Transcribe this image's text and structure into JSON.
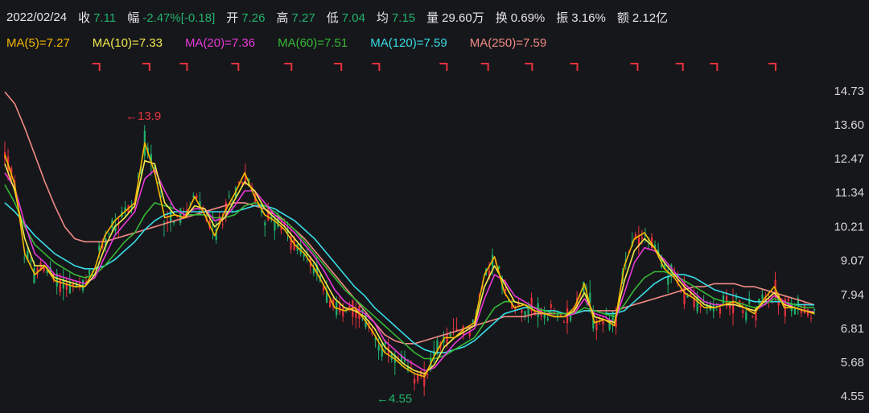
{
  "info": {
    "date": "2022/02/24",
    "close_label": "收",
    "close": "7.11",
    "change_label": "幅",
    "change": "-2.47%[-0.18]",
    "open_label": "开",
    "open": "7.26",
    "high_label": "高",
    "high": "7.27",
    "low_label": "低",
    "low": "7.04",
    "avg_label": "均",
    "avg": "7.15",
    "volume_label": "量",
    "volume": "29.60万",
    "turnover_label": "换",
    "turnover": "0.69%",
    "amplitude_label": "振",
    "amplitude": "3.16%",
    "amount_label": "额",
    "amount": "2.12亿"
  },
  "colors": {
    "background": "#16171b",
    "up": "#e8323c",
    "down": "#21b36b",
    "ma5": "#f5b800",
    "ma10": "#f2e94e",
    "ma20": "#e83ad8",
    "ma60": "#35b835",
    "ma120": "#38dde6",
    "ma250": "#f08a82"
  },
  "chart_data": {
    "type": "line",
    "yticks": [
      14.73,
      13.6,
      12.47,
      11.34,
      10.21,
      9.07,
      7.94,
      6.81,
      5.68,
      4.55
    ],
    "ylim": [
      4.55,
      14.73
    ],
    "annotations": [
      {
        "text": "←13.9",
        "value": 13.9,
        "kind": "high"
      },
      {
        "text": "←4.55",
        "value": 4.55,
        "kind": "low"
      }
    ],
    "signal_markers": 15,
    "series": [
      {
        "name": "MA(5)=7.27",
        "key": "ma5",
        "values": [
          12.6,
          11.6,
          9.3,
          8.6,
          8.9,
          8.4,
          8.3,
          8.2,
          8.2,
          8.8,
          9.9,
          10.4,
          10.7,
          11.0,
          13.0,
          12.0,
          10.5,
          10.6,
          10.5,
          11.2,
          10.6,
          9.9,
          10.7,
          11.3,
          12.0,
          11.2,
          10.6,
          10.4,
          10.1,
          9.6,
          9.3,
          8.8,
          8.2,
          7.5,
          7.4,
          7.5,
          7.1,
          6.6,
          6.0,
          5.8,
          5.5,
          5.3,
          5.2,
          5.9,
          6.5,
          6.5,
          6.8,
          7.0,
          8.6,
          9.2,
          8.0,
          7.5,
          7.6,
          7.4,
          7.3,
          7.2,
          7.2,
          7.5,
          8.3,
          7.0,
          7.1,
          6.9,
          8.9,
          9.8,
          10.0,
          9.5,
          8.8,
          8.5,
          8.0,
          7.8,
          7.5,
          7.5,
          7.6,
          7.7,
          7.5,
          7.3,
          7.8,
          8.2,
          7.5,
          7.5,
          7.4,
          7.3
        ]
      },
      {
        "name": "MA(10)=7.33",
        "key": "ma10",
        "values": [
          12.3,
          11.4,
          9.8,
          8.9,
          8.9,
          8.5,
          8.4,
          8.3,
          8.2,
          8.6,
          9.5,
          10.2,
          10.5,
          10.9,
          12.4,
          12.3,
          11.0,
          10.6,
          10.5,
          10.9,
          10.8,
          10.2,
          10.5,
          11.1,
          11.7,
          11.4,
          10.8,
          10.5,
          10.2,
          9.8,
          9.4,
          9.0,
          8.4,
          7.8,
          7.5,
          7.4,
          7.2,
          6.8,
          6.2,
          5.9,
          5.6,
          5.4,
          5.3,
          5.6,
          6.2,
          6.5,
          6.7,
          6.9,
          8.2,
          8.9,
          8.3,
          7.7,
          7.6,
          7.4,
          7.3,
          7.2,
          7.2,
          7.4,
          8.0,
          7.2,
          7.1,
          7.0,
          8.4,
          9.4,
          9.8,
          9.5,
          9.0,
          8.6,
          8.2,
          7.9,
          7.6,
          7.5,
          7.6,
          7.6,
          7.5,
          7.4,
          7.7,
          8.0,
          7.6,
          7.5,
          7.4,
          7.33
        ]
      },
      {
        "name": "MA(20)=7.36",
        "key": "ma20",
        "values": [
          12.0,
          11.5,
          10.3,
          9.3,
          9.0,
          8.6,
          8.5,
          8.4,
          8.3,
          8.5,
          9.2,
          9.9,
          10.3,
          10.7,
          11.8,
          12.1,
          11.4,
          10.8,
          10.6,
          10.8,
          10.8,
          10.4,
          10.5,
          10.9,
          11.4,
          11.4,
          11.0,
          10.6,
          10.3,
          10.0,
          9.6,
          9.2,
          8.7,
          8.1,
          7.7,
          7.5,
          7.3,
          7.0,
          6.4,
          6.1,
          5.8,
          5.6,
          5.4,
          5.5,
          5.9,
          6.3,
          6.6,
          6.8,
          7.8,
          8.6,
          8.4,
          7.9,
          7.7,
          7.5,
          7.3,
          7.2,
          7.2,
          7.3,
          7.8,
          7.3,
          7.2,
          7.0,
          8.0,
          9.0,
          9.5,
          9.4,
          9.1,
          8.7,
          8.3,
          8.0,
          7.7,
          7.6,
          7.6,
          7.6,
          7.5,
          7.4,
          7.6,
          7.9,
          7.7,
          7.5,
          7.4,
          7.36
        ]
      },
      {
        "name": "MA(60)=7.51",
        "key": "ma60",
        "values": [
          11.6,
          11.0,
          10.2,
          9.6,
          9.3,
          9.0,
          8.8,
          8.6,
          8.5,
          8.6,
          8.9,
          9.3,
          9.7,
          10.0,
          10.6,
          11.0,
          10.9,
          10.8,
          10.6,
          10.6,
          10.6,
          10.5,
          10.5,
          10.6,
          10.9,
          11.0,
          10.9,
          10.7,
          10.4,
          10.1,
          9.7,
          9.3,
          8.9,
          8.5,
          8.1,
          7.8,
          7.5,
          7.2,
          6.9,
          6.6,
          6.3,
          6.0,
          5.8,
          5.8,
          5.9,
          6.1,
          6.3,
          6.5,
          7.0,
          7.5,
          7.7,
          7.7,
          7.6,
          7.5,
          7.4,
          7.3,
          7.3,
          7.3,
          7.5,
          7.4,
          7.3,
          7.2,
          7.6,
          8.1,
          8.5,
          8.7,
          8.7,
          8.6,
          8.4,
          8.2,
          8.0,
          7.8,
          7.7,
          7.7,
          7.6,
          7.5,
          7.6,
          7.8,
          7.7,
          7.6,
          7.5,
          7.51
        ]
      },
      {
        "name": "MA(120)=7.59",
        "key": "ma120",
        "values": [
          11.0,
          10.7,
          10.3,
          9.9,
          9.6,
          9.3,
          9.1,
          8.9,
          8.8,
          8.8,
          8.9,
          9.1,
          9.4,
          9.7,
          10.1,
          10.4,
          10.6,
          10.7,
          10.7,
          10.7,
          10.7,
          10.7,
          10.7,
          10.7,
          10.8,
          10.9,
          10.9,
          10.8,
          10.6,
          10.4,
          10.1,
          9.8,
          9.4,
          9.0,
          8.6,
          8.2,
          7.9,
          7.5,
          7.2,
          6.9,
          6.6,
          6.3,
          6.1,
          6.0,
          6.0,
          6.1,
          6.2,
          6.4,
          6.7,
          7.0,
          7.3,
          7.4,
          7.5,
          7.5,
          7.4,
          7.4,
          7.3,
          7.3,
          7.4,
          7.4,
          7.3,
          7.3,
          7.4,
          7.7,
          8.0,
          8.3,
          8.5,
          8.6,
          8.6,
          8.5,
          8.3,
          8.1,
          8.0,
          7.9,
          7.8,
          7.7,
          7.7,
          7.7,
          7.7,
          7.6,
          7.6,
          7.59
        ]
      },
      {
        "name": "MA(250)=7.59",
        "key": "ma250",
        "values": [
          14.7,
          14.3,
          13.5,
          12.6,
          11.7,
          10.9,
          10.2,
          9.8,
          9.7,
          9.7,
          9.7,
          9.8,
          9.9,
          10.0,
          10.1,
          10.2,
          10.3,
          10.4,
          10.5,
          10.6,
          10.7,
          10.8,
          10.9,
          11.0,
          11.0,
          10.9,
          10.8,
          10.6,
          10.4,
          10.1,
          9.8,
          9.4,
          9.0,
          8.6,
          8.2,
          7.8,
          7.4,
          7.0,
          6.6,
          6.4,
          6.3,
          6.3,
          6.4,
          6.5,
          6.6,
          6.7,
          6.8,
          6.9,
          7.0,
          7.1,
          7.2,
          7.2,
          7.2,
          7.3,
          7.3,
          7.3,
          7.3,
          7.3,
          7.4,
          7.4,
          7.4,
          7.4,
          7.5,
          7.6,
          7.7,
          7.8,
          7.9,
          8.0,
          8.1,
          8.2,
          8.2,
          8.3,
          8.3,
          8.3,
          8.2,
          8.2,
          8.1,
          8.0,
          7.9,
          7.8,
          7.7,
          7.59
        ]
      }
    ]
  }
}
